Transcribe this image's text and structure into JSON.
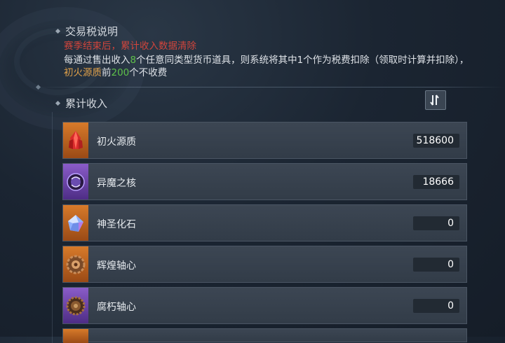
{
  "tax_section": {
    "title": "交易税说明",
    "warning": "赛季结束后，累计收入数据清除",
    "desc_part1": "每通过售出收入",
    "desc_num1": "8",
    "desc_part2": "个任意同类型货币道具，则系统将其中1个作为税费扣除（领取时计算并扣除），",
    "desc_item": "初火源质",
    "desc_part3": "前",
    "desc_num2": "200",
    "desc_part4": "个不收费"
  },
  "income_section": {
    "title": "累计收入",
    "sort_icon": "sort-toggle-icon"
  },
  "items": [
    {
      "name": "初火源质",
      "value": "518600",
      "icon": "red-crystal-icon",
      "bg": "orange"
    },
    {
      "name": "异魔之核",
      "value": "18666",
      "icon": "dark-orb-icon",
      "bg": "purple"
    },
    {
      "name": "神圣化石",
      "value": "0",
      "icon": "holy-gem-icon",
      "bg": "orange"
    },
    {
      "name": "辉煌轴心",
      "value": "0",
      "icon": "gold-gear-icon",
      "bg": "orange"
    },
    {
      "name": "腐朽轴心",
      "value": "0",
      "icon": "rust-gear-icon",
      "bg": "purple"
    }
  ],
  "colors": {
    "warning": "#d0453c",
    "highlight_number": "#5ec04a",
    "highlight_item": "#e0a14a"
  }
}
